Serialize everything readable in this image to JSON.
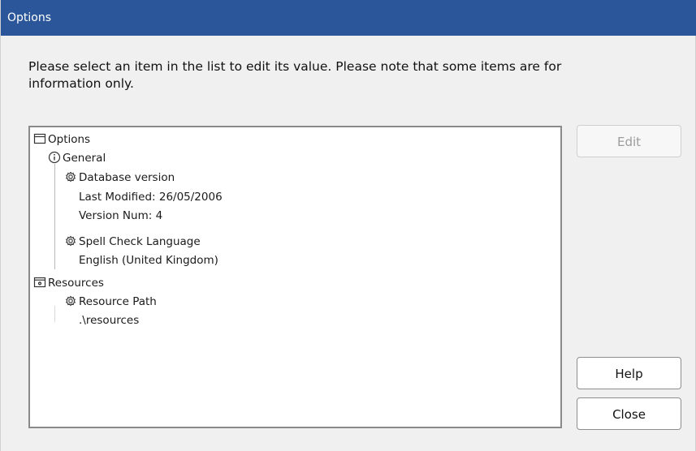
{
  "window": {
    "title": "Options"
  },
  "instructions": "Please select an item in the list to edit its value. Please note that some items are for information only.",
  "tree": {
    "root": {
      "label": "Options",
      "icon": "window-icon"
    },
    "general": {
      "label": "General",
      "icon": "info-icon",
      "database_version": {
        "label": "Database version",
        "icon": "gear-icon",
        "details": [
          "Last Modified: 26/05/2006",
          "Version Num: 4"
        ]
      },
      "spell_check": {
        "label": "Spell Check Language",
        "icon": "gear-icon",
        "details": [
          "English (United Kingdom)"
        ]
      }
    },
    "resources": {
      "label": "Resources",
      "icon": "resources-icon",
      "resource_path": {
        "label": "Resource Path",
        "icon": "gear-icon",
        "details": [
          ".\\resources"
        ]
      }
    }
  },
  "buttons": {
    "edit": "Edit",
    "help": "Help",
    "close": "Close"
  },
  "colors": {
    "titlebar": "#2b579a",
    "dialog_bg": "#f0f0f0"
  }
}
